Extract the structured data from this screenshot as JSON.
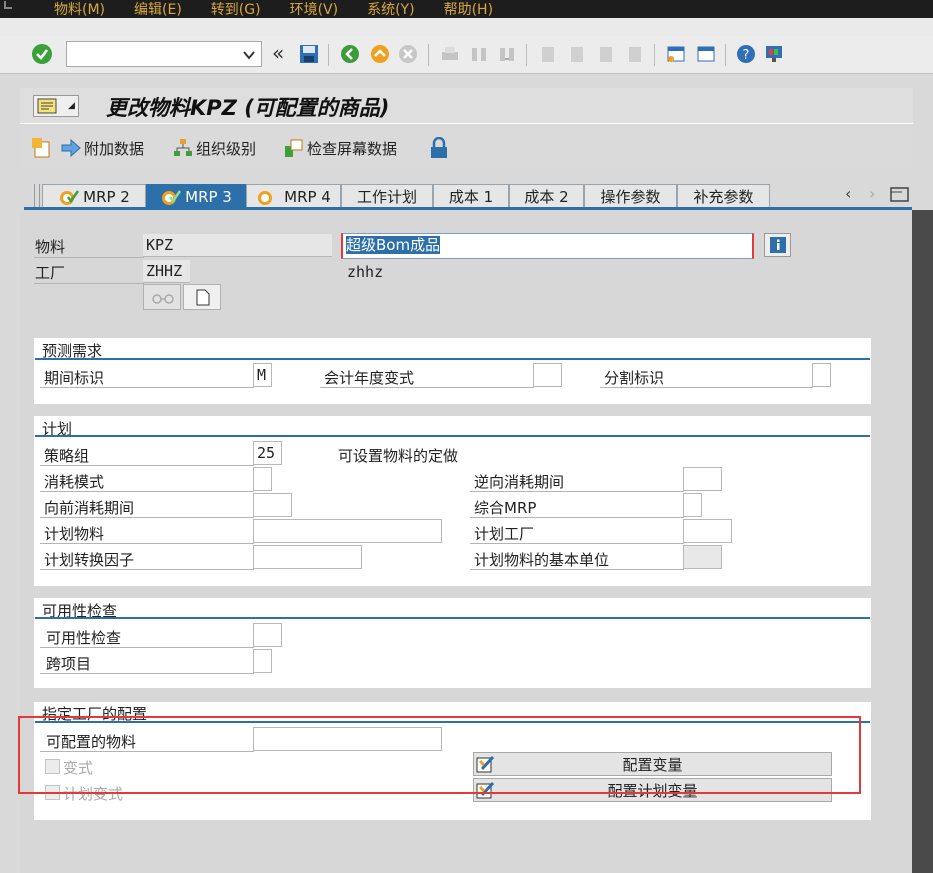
{
  "menu": {
    "items": [
      "物料(M)",
      "编辑(E)",
      "转到(G)",
      "环境(V)",
      "系统(Y)",
      "帮助(H)"
    ]
  },
  "toolbar": {
    "command_value": "",
    "icons": [
      "check-icon",
      "save-icon",
      "back-icon",
      "exit-icon",
      "cancel-icon",
      "print-icon",
      "find-icon",
      "find-next-icon",
      "first-page-icon",
      "prev-page-icon",
      "next-page-icon",
      "last-page-icon",
      "new-session-icon",
      "shortcut-icon",
      "help-icon",
      "layout-icon"
    ]
  },
  "title": {
    "text": "更改物料KPZ (可配置的商品)"
  },
  "appbar": {
    "additional_data": "附加数据",
    "org_levels": "组织级别",
    "check_screen": "检查屏幕数据"
  },
  "tabs": [
    {
      "label": "MRP 2",
      "active": false,
      "icon": "status-check-icon"
    },
    {
      "label": "MRP 3",
      "active": true,
      "icon": "status-check-icon"
    },
    {
      "label": "MRP 4",
      "active": false,
      "icon": "status-icon"
    },
    {
      "label": "工作计划",
      "active": false
    },
    {
      "label": "成本 1",
      "active": false
    },
    {
      "label": "成本 2",
      "active": false
    },
    {
      "label": "操作参数",
      "active": false
    },
    {
      "label": "补充参数",
      "active": false
    }
  ],
  "header": {
    "material_label": "物料",
    "material_value": "KPZ",
    "material_desc": "超级Bom成品",
    "plant_label": "工厂",
    "plant_value": "ZHHZ",
    "plant_desc": "zhhz"
  },
  "forecast": {
    "title": "预测需求",
    "period_label": "期间标识",
    "period_value": "M",
    "fiscal_label": "会计年度变式",
    "fiscal_value": "",
    "split_label": "分割标识",
    "split_value": ""
  },
  "planning": {
    "title": "计划",
    "strategy_label": "策略组",
    "strategy_value": "25",
    "strategy_desc": "可设置物料的定做",
    "consumption_mode_label": "消耗模式",
    "consumption_mode_value": "",
    "backward_label": "逆向消耗期间",
    "backward_value": "",
    "forward_label": "向前消耗期间",
    "forward_value": "",
    "mixed_mrp_label": "综合MRP",
    "mixed_mrp_value": "",
    "plan_material_label": "计划物料",
    "plan_material_value": "",
    "plan_plant_label": "计划工厂",
    "plan_plant_value": "",
    "conv_factor_label": "计划转换因子",
    "conv_factor_value": "",
    "base_unit_label": "计划物料的基本单位",
    "base_unit_value": ""
  },
  "availability": {
    "title": "可用性检查",
    "check_label": "可用性检查",
    "check_value": "",
    "cross_label": "跨项目",
    "cross_value": ""
  },
  "config": {
    "title": "指定工厂的配置",
    "configurable_label": "可配置的物料",
    "configurable_value": "",
    "variant_label": "变式",
    "plan_variant_label": "计划变式",
    "config_variant_btn": "配置变量",
    "config_plan_variant_btn": "配置计划变量"
  },
  "colors": {
    "accent": "#2d6fa8",
    "highlight": "#e03a3a",
    "menu_text": "#d9a640"
  }
}
